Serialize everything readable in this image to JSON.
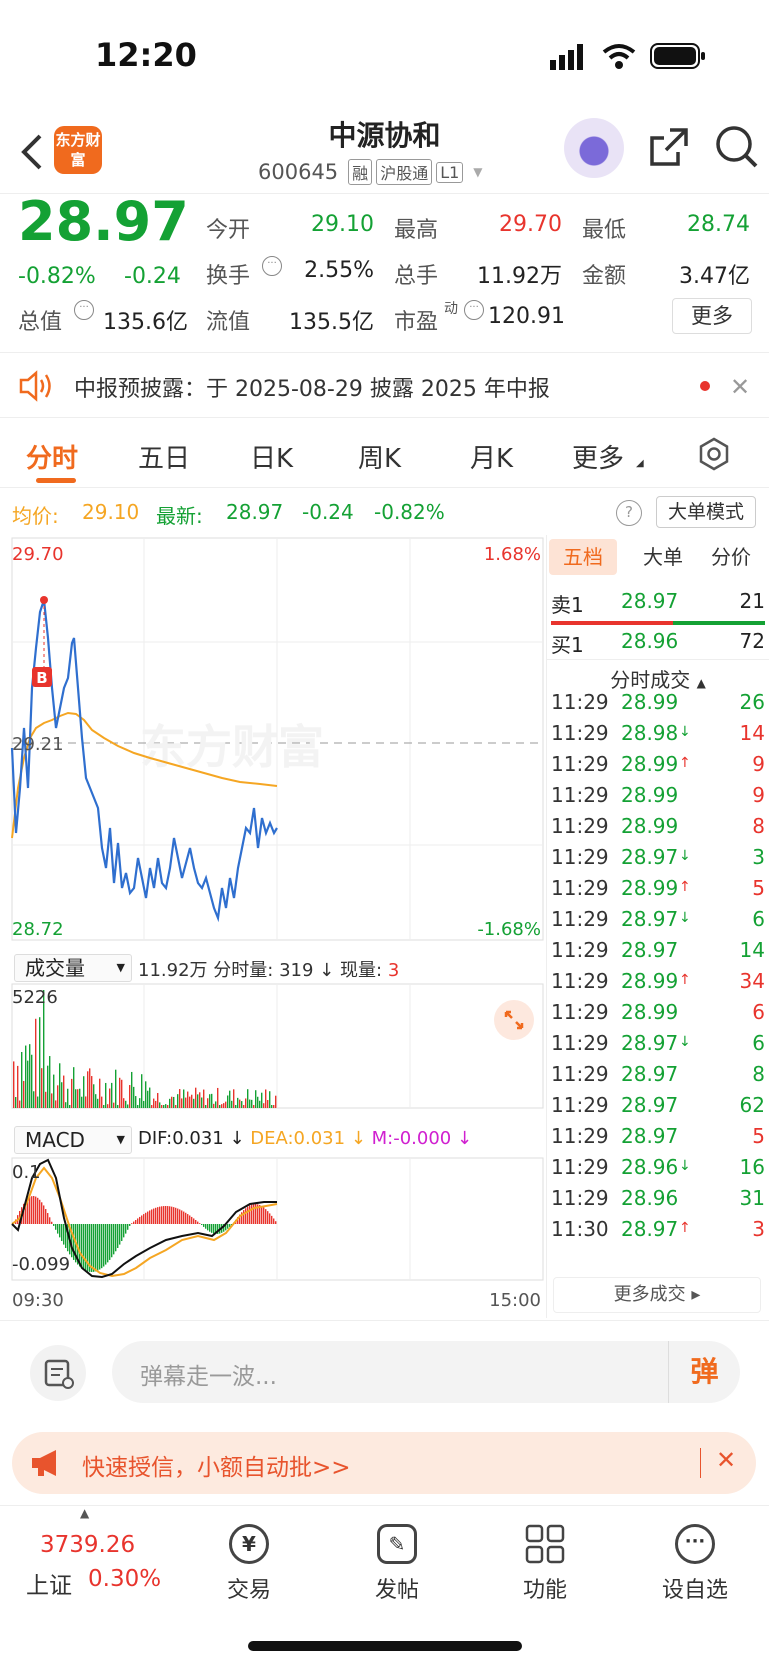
{
  "status_bar": {
    "time": "12:20"
  },
  "header": {
    "logo_text": "东方财富",
    "stock_name": "中源协和",
    "stock_code": "600645",
    "tags": [
      "融",
      "沪股通",
      "L1"
    ]
  },
  "quote": {
    "price": "28.97",
    "change_pct": "-0.82%",
    "change_amt": "-0.24",
    "open_label": "今开",
    "open": "29.10",
    "high_label": "最高",
    "high": "29.70",
    "low_label": "最低",
    "low": "28.74",
    "turnover_label": "换手",
    "turnover": "2.55%",
    "volume_label": "总手",
    "volume": "11.92万",
    "amount_label": "金额",
    "amount": "3.47亿",
    "mktcap_label": "总值",
    "mktcap": "135.6亿",
    "float_label": "流值",
    "float_cap": "135.5亿",
    "pe_label": "市盈",
    "pe_sup": "动",
    "pe": "120.91",
    "more_button": "更多"
  },
  "notice": {
    "text": "中报预披露：于 2025-08-29 披露 2025 年中报"
  },
  "tabs": [
    "分时",
    "五日",
    "日K",
    "周K",
    "月K",
    "更多"
  ],
  "chart_info": {
    "avg_label": "均价:",
    "avg_value": "29.10",
    "latest_label": "最新:",
    "latest_value": "28.97",
    "latest_change": "-0.24",
    "latest_pct": "-0.82%",
    "big_order_button": "大单模式"
  },
  "price_axis": {
    "max": "29.70",
    "min": "28.72",
    "pct_max": "1.68%",
    "pct_min": "-1.68%",
    "prev_close": "29.21",
    "watermark": "东方财富",
    "marker": "B"
  },
  "volume_panel": {
    "selector": "成交量",
    "total": "11.92万",
    "period_label": "分时量:",
    "period_value": "319",
    "current_label": "现量:",
    "current_value": "3",
    "max_label": "5226"
  },
  "macd_panel": {
    "selector": "MACD",
    "dif": "DIF:0.031",
    "dea": "DEA:0.031",
    "m": "M:-0.000",
    "max_label": "0.1",
    "min_label": "-0.099"
  },
  "time_axis": {
    "start": "09:30",
    "end": "15:00"
  },
  "right_tabs": [
    "五档",
    "大单",
    "分价"
  ],
  "order_book": {
    "sell1_label": "卖1",
    "sell1_price": "28.97",
    "sell1_vol": "21",
    "buy1_label": "买1",
    "buy1_price": "28.96",
    "buy1_vol": "72"
  },
  "ticks_header": "分时成交",
  "ticks": [
    {
      "time": "11:29",
      "price": "28.99",
      "arrow": "",
      "vol": "26",
      "color": "#14a134"
    },
    {
      "time": "11:29",
      "price": "28.98",
      "arrow": "↓",
      "vol": "14",
      "color": "#e8342d"
    },
    {
      "time": "11:29",
      "price": "28.99",
      "arrow": "↑",
      "vol": "9",
      "color": "#e8342d"
    },
    {
      "time": "11:29",
      "price": "28.99",
      "arrow": "",
      "vol": "9",
      "color": "#e8342d"
    },
    {
      "time": "11:29",
      "price": "28.99",
      "arrow": "",
      "vol": "8",
      "color": "#e8342d"
    },
    {
      "time": "11:29",
      "price": "28.97",
      "arrow": "↓",
      "vol": "3",
      "color": "#14a134"
    },
    {
      "time": "11:29",
      "price": "28.99",
      "arrow": "↑",
      "vol": "5",
      "color": "#e8342d"
    },
    {
      "time": "11:29",
      "price": "28.97",
      "arrow": "↓",
      "vol": "6",
      "color": "#14a134"
    },
    {
      "time": "11:29",
      "price": "28.97",
      "arrow": "",
      "vol": "14",
      "color": "#14a134"
    },
    {
      "time": "11:29",
      "price": "28.99",
      "arrow": "↑",
      "vol": "34",
      "color": "#e8342d"
    },
    {
      "time": "11:29",
      "price": "28.99",
      "arrow": "",
      "vol": "6",
      "color": "#e8342d"
    },
    {
      "time": "11:29",
      "price": "28.97",
      "arrow": "↓",
      "vol": "6",
      "color": "#14a134"
    },
    {
      "time": "11:29",
      "price": "28.97",
      "arrow": "",
      "vol": "8",
      "color": "#14a134"
    },
    {
      "time": "11:29",
      "price": "28.97",
      "arrow": "",
      "vol": "62",
      "color": "#14a134"
    },
    {
      "time": "11:29",
      "price": "28.97",
      "arrow": "",
      "vol": "5",
      "color": "#e8342d"
    },
    {
      "time": "11:29",
      "price": "28.96",
      "arrow": "↓",
      "vol": "16",
      "color": "#14a134"
    },
    {
      "time": "11:29",
      "price": "28.96",
      "arrow": "",
      "vol": "31",
      "color": "#14a134"
    },
    {
      "time": "11:30",
      "price": "28.97",
      "arrow": "↑",
      "vol": "3",
      "color": "#e8342d"
    }
  ],
  "more_ticks": "更多成交 ▸",
  "comment": {
    "placeholder": "弹幕走一波...",
    "danmaku_button": "弹"
  },
  "banner": {
    "text": "快速授信，小额自动批>>"
  },
  "tabbar": {
    "index_value": "3739.26",
    "index_name": "上证",
    "index_pct": "0.30%",
    "items": [
      "交易",
      "发帖",
      "功能",
      "设自选"
    ]
  },
  "colors": {
    "up": "#e8342d",
    "down": "#14a134",
    "accent": "#f06a1e",
    "avg_line": "#f5a623",
    "price_line": "#2f6fcf"
  }
}
